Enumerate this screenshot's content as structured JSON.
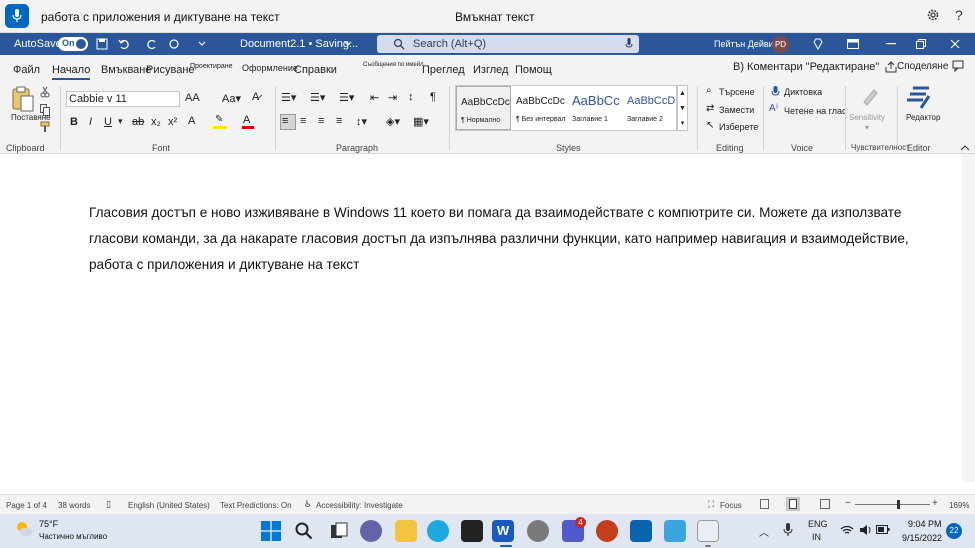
{
  "voice_access": {
    "command_text": "работа с приложения и диктуване на текст",
    "status_text": "Вмъкнат текст",
    "help_label": "?"
  },
  "titlebar": {
    "autosave_label": "AutoSave",
    "autosave_state": "On",
    "doc_title": "Document2.1 • Saving...",
    "search_placeholder": "Search (Alt+Q)",
    "user_name": "Пейтън Дейвис",
    "user_initials": "PD"
  },
  "tabs": [
    "Файл",
    "Начало",
    "Вмъкване",
    "Рисуване",
    "Проектиране",
    "Оформление",
    "Справки",
    "Съобщения по имейл",
    "Преглед",
    "Изглед",
    "Помощ"
  ],
  "ribbon": {
    "comments_label": "В) Коментари \"Редактиране\"",
    "share_label": "Споделяне",
    "clipboard": {
      "paste_label": "Поставяне",
      "group_label": "Clipboard"
    },
    "font": {
      "font_name": "Cabbie v 11",
      "group_label": "Font"
    },
    "paragraph": {
      "group_label": "Paragraph"
    },
    "styles": {
      "group_label": "Styles",
      "items": [
        {
          "preview": "AaBbCcDc",
          "name": "¶ Нормално"
        },
        {
          "preview": "AaBbCcDc",
          "name": "¶ Без интервал"
        },
        {
          "preview": "AaBbCc",
          "name": "Заглавие 1"
        },
        {
          "preview": "AaBbCcD",
          "name": "Заглавие 2"
        }
      ]
    },
    "editing": {
      "find": "Търсене",
      "replace": "Замести",
      "select": "Изберете",
      "group_label": "Editing"
    },
    "voice": {
      "dictate": "Диктовка",
      "read_aloud": "Четене на глас",
      "group_label": "Voice"
    },
    "sensitivity": {
      "label": "Sensitivity",
      "group_label": "Чувствителност"
    },
    "editor": {
      "label": "Редактор",
      "group_label": "Editor"
    }
  },
  "document": {
    "body": "Гласовия достъп е ново изживяване в Windows 11 което ви помага да взаимодействате с компютрите си. Можете да използвате гласови команди, за да накарате гласовия достъп да изпълнява различни функции, като например навигация и взаимодействие, работа с приложения и диктуване на текст"
  },
  "statusbar": {
    "page": "Page 1 of 4",
    "words": "38 words",
    "language": "English (United States)",
    "predictions": "Text Predictions: On",
    "accessibility": "Accessibility: Investigate",
    "focus": "Focus",
    "zoom": "169%"
  },
  "taskbar": {
    "weather_temp": "75°F",
    "weather_desc": "Частично мъгливо",
    "teams_badge": "4",
    "lang_top": "ENG",
    "lang_bottom": "IN",
    "time": "9:04 PM",
    "date": "9/15/2022",
    "notif_count": "22"
  },
  "colors": {
    "word_blue": "#2b579a",
    "voice_blue": "#0067c0",
    "taskbar": "#dfe6f1"
  }
}
